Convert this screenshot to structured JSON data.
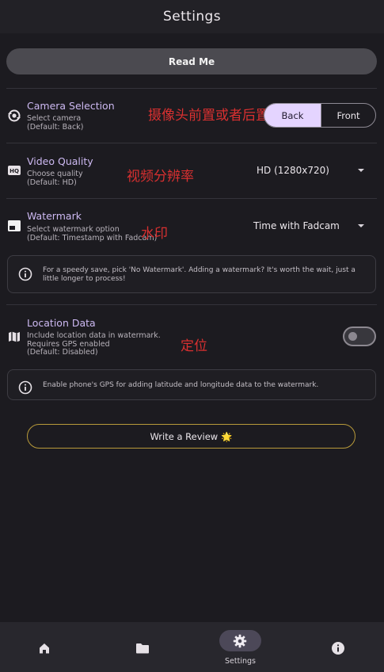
{
  "header": {
    "title": "Settings"
  },
  "readme": {
    "label": "Read Me"
  },
  "camera": {
    "title": "Camera Selection",
    "desc_line1": "Select camera",
    "desc_line2": "(Default: Back)",
    "annotation": "摄像头前置或者后置",
    "options": [
      "Back",
      "Front"
    ],
    "selected": "Back"
  },
  "video": {
    "title": "Video Quality",
    "desc_line1": "Choose quality",
    "desc_line2": "(Default: HD)",
    "annotation": "视频分辨率",
    "value": "HD (1280x720)"
  },
  "watermark": {
    "title": "Watermark",
    "desc_line1": "Select watermark option",
    "desc_line2": "(Default: Timestamp with Fadcam)",
    "annotation": "水印",
    "value": "Time with Fadcam",
    "info": "For a speedy save, pick 'No Watermark'. Adding a watermark? It's worth the wait, just a little longer to process!"
  },
  "location": {
    "title": "Location Data",
    "desc_line1": "Include location data in watermark.",
    "desc_line2": "Requires GPS enabled",
    "desc_line3": "(Default: Disabled)",
    "annotation": "定位",
    "enabled": false,
    "info": "Enable phone's GPS for adding latitude and longitude data to the watermark."
  },
  "review": {
    "label": "Write a Review",
    "star": "🌟"
  },
  "bottom_nav": {
    "items": [
      {
        "icon": "home-icon"
      },
      {
        "icon": "folder-icon"
      },
      {
        "icon": "gear-icon",
        "label": "Settings",
        "active": true
      },
      {
        "icon": "info-icon"
      }
    ]
  },
  "colors": {
    "background": "#1c1b20",
    "accent": "#cdb9f2",
    "segment_selected": "#e4d4ff",
    "annotation": "#d93030",
    "review_border": "#b89a3a"
  }
}
